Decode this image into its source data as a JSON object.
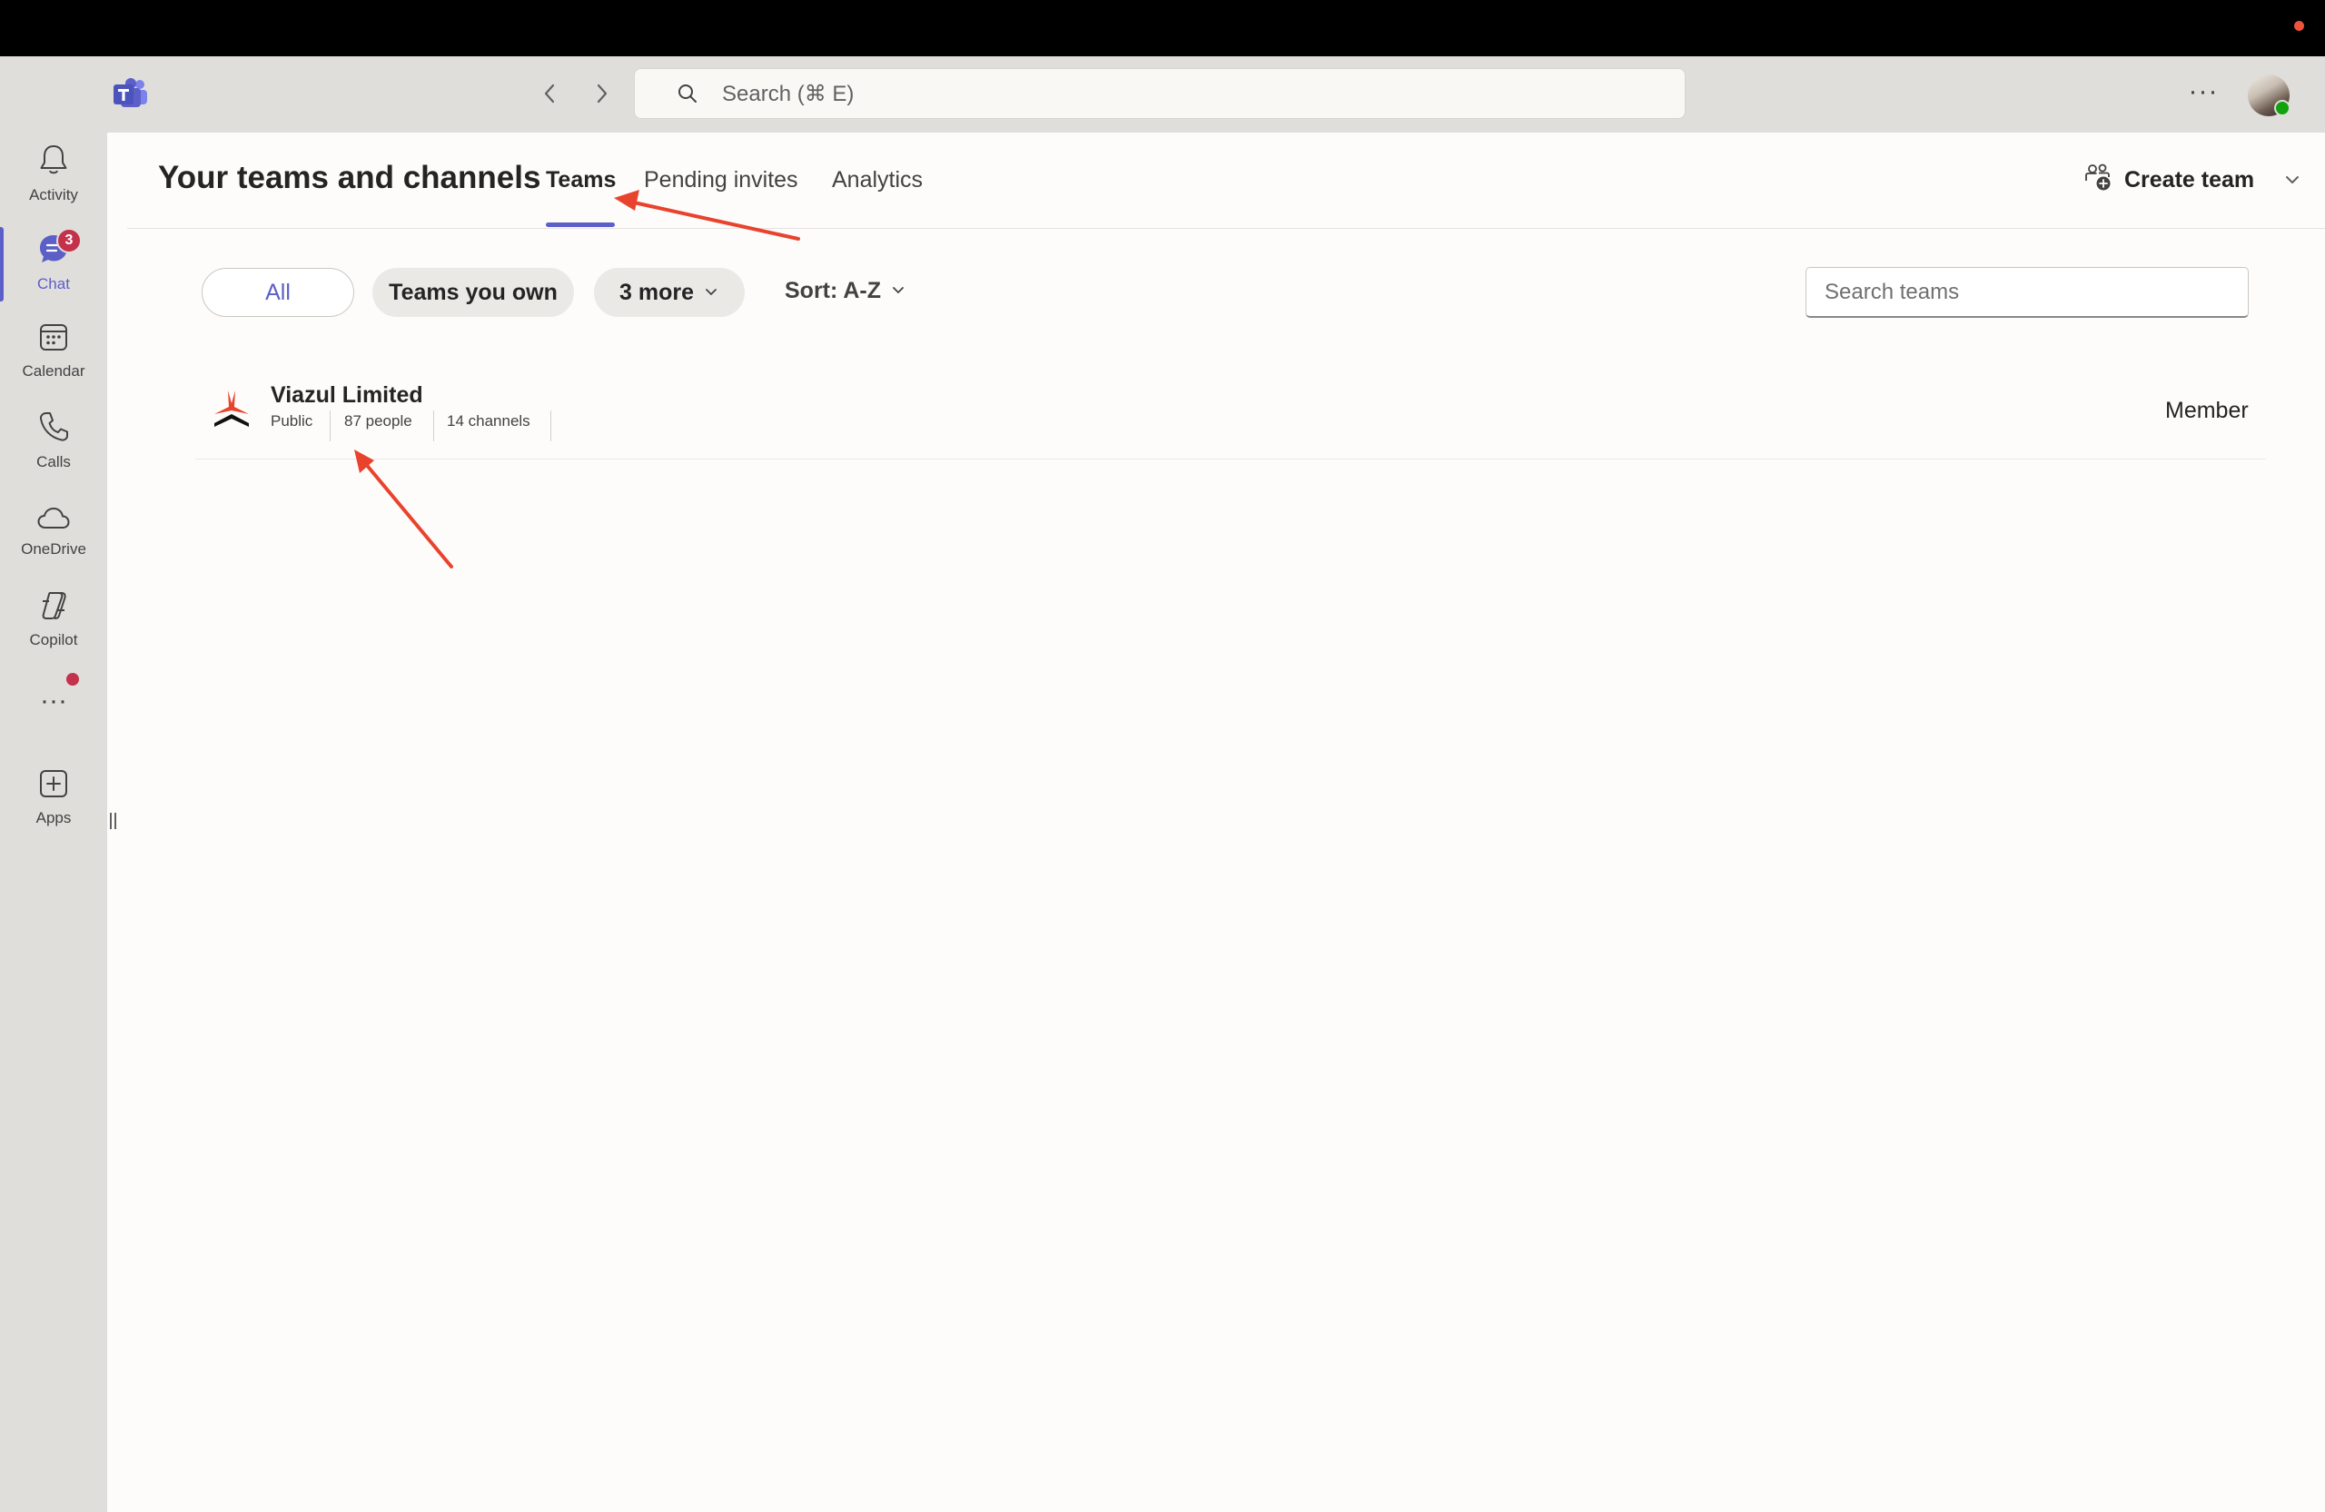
{
  "titlebar": {
    "search_placeholder": "Search (⌘ E)",
    "more_label": "···"
  },
  "rail": {
    "items": [
      {
        "label": "Activity",
        "icon": "bell-icon"
      },
      {
        "label": "Chat",
        "icon": "chat-icon",
        "badge": "3",
        "active": true
      },
      {
        "label": "Calendar",
        "icon": "calendar-icon"
      },
      {
        "label": "Calls",
        "icon": "phone-icon"
      },
      {
        "label": "OneDrive",
        "icon": "cloud-icon"
      },
      {
        "label": "Copilot",
        "icon": "copilot-icon"
      },
      {
        "label": "Apps",
        "icon": "add-app-icon"
      }
    ],
    "more_label": "···"
  },
  "header": {
    "title": "Your teams and channels",
    "tabs": [
      {
        "label": "Teams",
        "active": true
      },
      {
        "label": "Pending invites"
      },
      {
        "label": "Analytics"
      }
    ],
    "create_team_label": "Create team"
  },
  "filters": {
    "all_label": "All",
    "own_label": "Teams you own",
    "more_label": "3 more",
    "sort_label": "Sort: A-Z",
    "search_placeholder": "Search teams"
  },
  "teams": [
    {
      "name": "Viazul Limited",
      "visibility": "Public",
      "people": "87 people",
      "channels": "14 channels",
      "role": "Member"
    }
  ],
  "colors": {
    "accent": "#5b5fc7",
    "badge": "#c4314b",
    "annotation_arrow": "#e8432d",
    "rail_bg": "#e0dedb"
  }
}
